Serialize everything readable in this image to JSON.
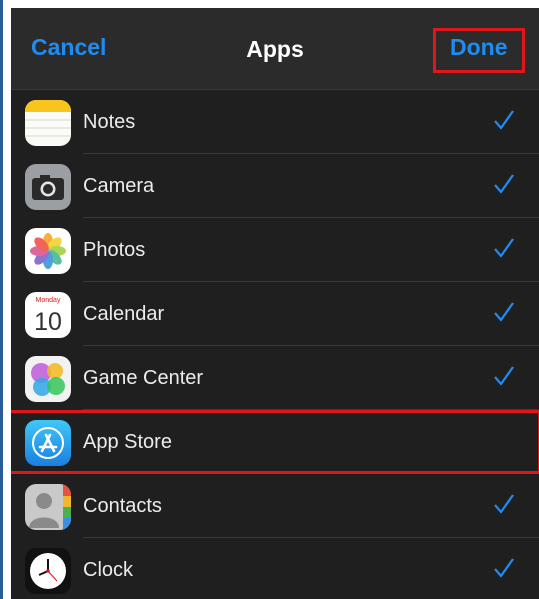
{
  "navbar": {
    "cancel_label": "Cancel",
    "title": "Apps",
    "done_label": "Done"
  },
  "apps": [
    {
      "name": "Notes",
      "icon": "notes-icon",
      "checked": true
    },
    {
      "name": "Camera",
      "icon": "camera-icon",
      "checked": true
    },
    {
      "name": "Photos",
      "icon": "photos-icon",
      "checked": true
    },
    {
      "name": "Calendar",
      "icon": "calendar-icon",
      "checked": true,
      "icon_text": {
        "month": "Monday",
        "day": "10"
      }
    },
    {
      "name": "Game Center",
      "icon": "game-center-icon",
      "checked": true
    },
    {
      "name": "App Store",
      "icon": "app-store-icon",
      "checked": false,
      "highlighted": true
    },
    {
      "name": "Contacts",
      "icon": "contacts-icon",
      "checked": true
    },
    {
      "name": "Clock",
      "icon": "clock-icon",
      "checked": true
    }
  ],
  "colors": {
    "accent": "#1f8cf2",
    "highlight": "#e0161b",
    "background": "#1f1f1f",
    "navbar": "#2b2b2b"
  }
}
